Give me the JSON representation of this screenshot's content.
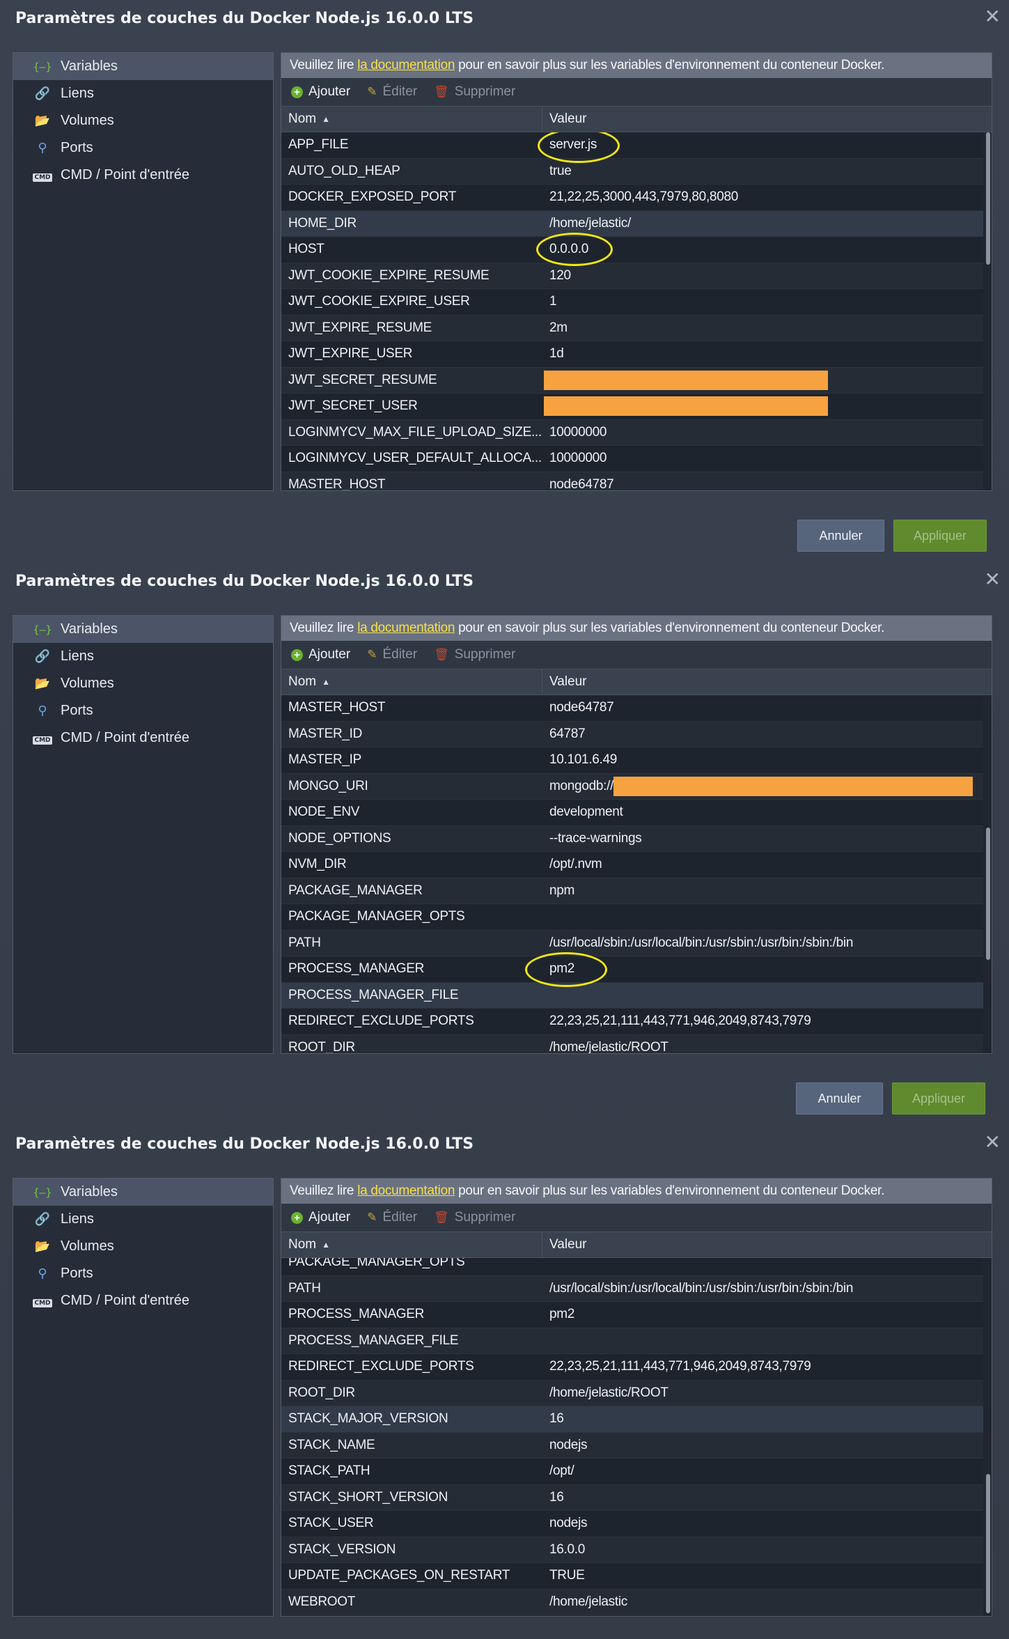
{
  "panels": [
    {
      "title": "Paramètres de couches du Docker Node.js 16.0.0 LTS",
      "sidebar": [
        "Variables",
        "Liens",
        "Volumes",
        "Ports",
        "CMD / Point d'entrée"
      ],
      "info": {
        "before": "Veuillez lire ",
        "link": "la documentation",
        "after": " pour en savoir plus sur les variables d'environnement du conteneur Docker."
      },
      "toolbar": {
        "add": "Ajouter",
        "edit": "Éditer",
        "delete": "Supprimer"
      },
      "columns": {
        "name": "Nom",
        "value": "Valeur"
      },
      "rows": [
        {
          "name": "APP_FILE",
          "value": "server.js"
        },
        {
          "name": "AUTO_OLD_HEAP",
          "value": "true"
        },
        {
          "name": "DOCKER_EXPOSED_PORT",
          "value": "21,22,25,3000,443,7979,80,8080"
        },
        {
          "name": "HOME_DIR",
          "value": "/home/jelastic/"
        },
        {
          "name": "HOST",
          "value": "0.0.0.0"
        },
        {
          "name": "JWT_COOKIE_EXPIRE_RESUME",
          "value": "120"
        },
        {
          "name": "JWT_COOKIE_EXPIRE_USER",
          "value": "1"
        },
        {
          "name": "JWT_EXPIRE_RESUME",
          "value": "2m"
        },
        {
          "name": "JWT_EXPIRE_USER",
          "value": "1d"
        },
        {
          "name": "JWT_SECRET_RESUME",
          "value": ""
        },
        {
          "name": "JWT_SECRET_USER",
          "value": ""
        },
        {
          "name": "LOGINMYCV_MAX_FILE_UPLOAD_SIZE...",
          "value": "10000000"
        },
        {
          "name": "LOGINMYCV_USER_DEFAULT_ALLOCA...",
          "value": "10000000"
        },
        {
          "name": "MASTER_HOST",
          "value": "node64787"
        }
      ],
      "buttons": {
        "cancel": "Annuler",
        "apply": "Appliquer"
      }
    },
    {
      "title": "Paramètres de couches du Docker Node.js 16.0.0 LTS",
      "sidebar": [
        "Variables",
        "Liens",
        "Volumes",
        "Ports",
        "CMD / Point d'entrée"
      ],
      "info": {
        "before": "Veuillez lire ",
        "link": "la documentation",
        "after": " pour en savoir plus sur les variables d'environnement du conteneur Docker."
      },
      "toolbar": {
        "add": "Ajouter",
        "edit": "Éditer",
        "delete": "Supprimer"
      },
      "columns": {
        "name": "Nom",
        "value": "Valeur"
      },
      "rows": [
        {
          "name": "MASTER_HOST",
          "value": "node64787"
        },
        {
          "name": "MASTER_ID",
          "value": "64787"
        },
        {
          "name": "MASTER_IP",
          "value": "10.101.6.49"
        },
        {
          "name": "MONGO_URI",
          "value": "mongodb://"
        },
        {
          "name": "NODE_ENV",
          "value": "development"
        },
        {
          "name": "NODE_OPTIONS",
          "value": "--trace-warnings"
        },
        {
          "name": "NVM_DIR",
          "value": "/opt/.nvm"
        },
        {
          "name": "PACKAGE_MANAGER",
          "value": "npm"
        },
        {
          "name": "PACKAGE_MANAGER_OPTS",
          "value": ""
        },
        {
          "name": "PATH",
          "value": "/usr/local/sbin:/usr/local/bin:/usr/sbin:/usr/bin:/sbin:/bin"
        },
        {
          "name": "PROCESS_MANAGER",
          "value": "pm2"
        },
        {
          "name": "PROCESS_MANAGER_FILE",
          "value": ""
        },
        {
          "name": "REDIRECT_EXCLUDE_PORTS",
          "value": "22,23,25,21,111,443,771,946,2049,8743,7979"
        },
        {
          "name": "ROOT_DIR",
          "value": "/home/jelastic/ROOT"
        }
      ],
      "buttons": {
        "cancel": "Annuler",
        "apply": "Appliquer"
      }
    },
    {
      "title": "Paramètres de couches du Docker Node.js 16.0.0 LTS",
      "sidebar": [
        "Variables",
        "Liens",
        "Volumes",
        "Ports",
        "CMD / Point d'entrée"
      ],
      "info": {
        "before": "Veuillez lire ",
        "link": "la documentation",
        "after": " pour en savoir plus sur les variables d'environnement du conteneur Docker."
      },
      "toolbar": {
        "add": "Ajouter",
        "edit": "Éditer",
        "delete": "Supprimer"
      },
      "columns": {
        "name": "Nom",
        "value": "Valeur"
      },
      "rows": [
        {
          "name": "PACKAGE_MANAGER_OPTS",
          "value": ""
        },
        {
          "name": "PATH",
          "value": "/usr/local/sbin:/usr/local/bin:/usr/sbin:/usr/bin:/sbin:/bin"
        },
        {
          "name": "PROCESS_MANAGER",
          "value": "pm2"
        },
        {
          "name": "PROCESS_MANAGER_FILE",
          "value": ""
        },
        {
          "name": "REDIRECT_EXCLUDE_PORTS",
          "value": "22,23,25,21,111,443,771,946,2049,8743,7979"
        },
        {
          "name": "ROOT_DIR",
          "value": "/home/jelastic/ROOT"
        },
        {
          "name": "STACK_MAJOR_VERSION",
          "value": "16"
        },
        {
          "name": "STACK_NAME",
          "value": "nodejs"
        },
        {
          "name": "STACK_PATH",
          "value": "/opt/"
        },
        {
          "name": "STACK_SHORT_VERSION",
          "value": "16"
        },
        {
          "name": "STACK_USER",
          "value": "nodejs"
        },
        {
          "name": "STACK_VERSION",
          "value": "16.0.0"
        },
        {
          "name": "UPDATE_PACKAGES_ON_RESTART",
          "value": "TRUE"
        },
        {
          "name": "WEBROOT",
          "value": "/home/jelastic"
        }
      ],
      "buttons": {
        "cancel": "",
        "apply": ""
      }
    }
  ],
  "colors": {
    "accent_link": "#f7e04a",
    "highlight_circle": "#f2e614",
    "redaction": "#f6a240",
    "apply_button": "#5f8a2e",
    "cancel_button": "#56647c"
  }
}
